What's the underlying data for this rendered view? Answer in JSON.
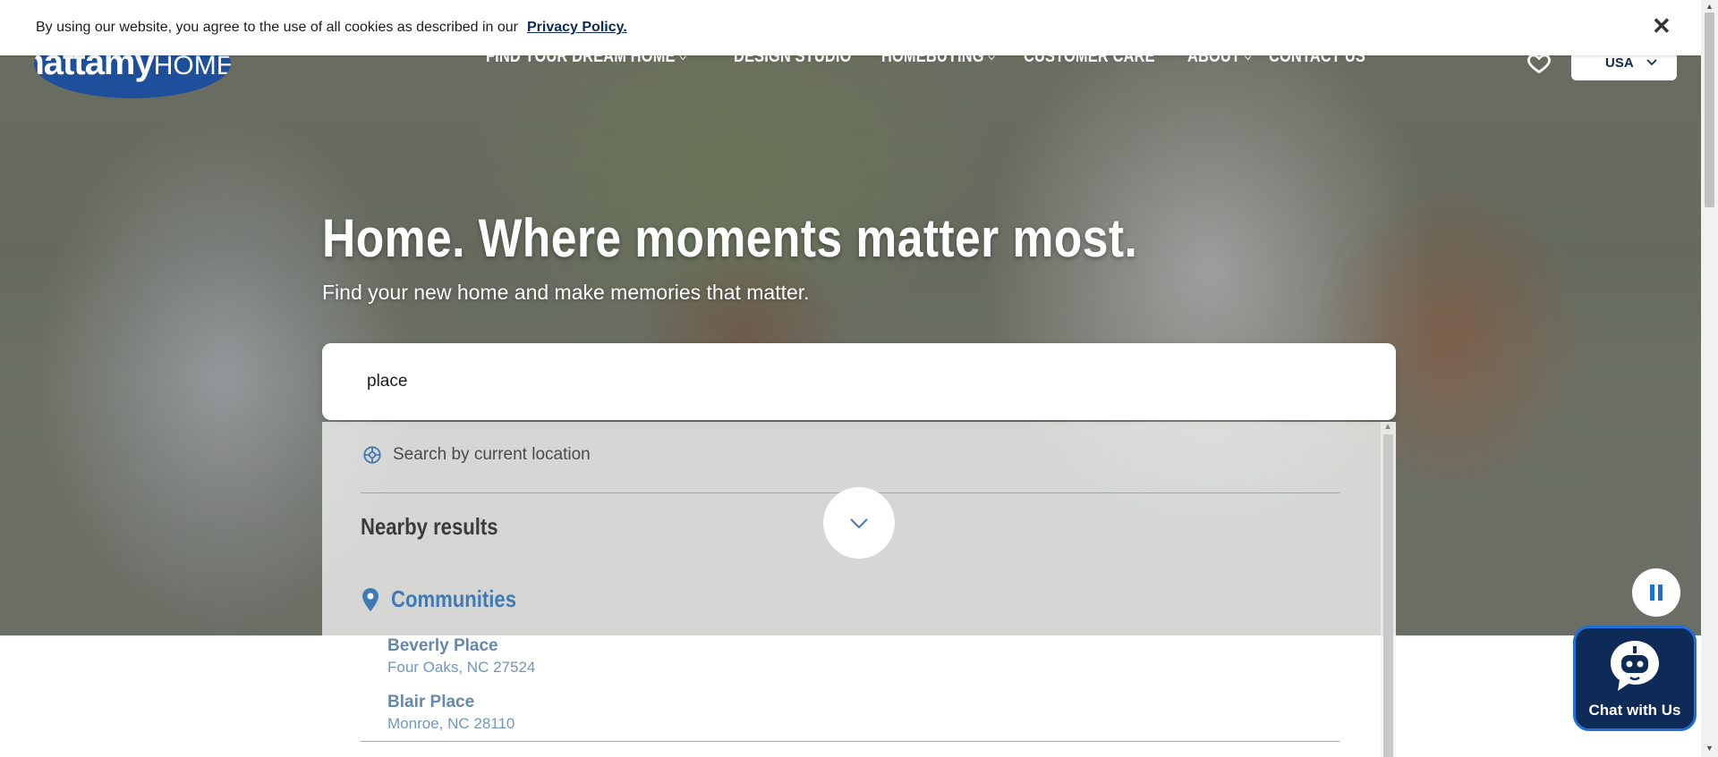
{
  "header": {
    "logo_main": "mattamy",
    "logo_sub": "HOMES",
    "nav": [
      {
        "label": "FIND YOUR DREAM HOME",
        "has_dropdown": true
      },
      {
        "label": "DESIGN STUDIO",
        "has_dropdown": false
      },
      {
        "label": "HOMEBUYING",
        "has_dropdown": true
      },
      {
        "label": "CUSTOMER CARE",
        "has_dropdown": false
      },
      {
        "label": "ABOUT",
        "has_dropdown": true
      },
      {
        "label": "CONTACT US",
        "has_dropdown": false
      }
    ],
    "country": "USA"
  },
  "cookie_banner": {
    "text": "By using our website, you agree to the use of all cookies as described in our",
    "link": "Privacy Policy.",
    "close": "✕"
  },
  "hero": {
    "headline": "Home. Where moments matter most.",
    "subhead": "Find your new home and make memories that matter."
  },
  "search": {
    "value": "place",
    "current_location": "Search by current location",
    "nearby_heading": "Nearby results",
    "communities_heading": "Communities",
    "results": [
      {
        "name": "Beverly Place",
        "address": "Four Oaks, NC 27524"
      },
      {
        "name": "Blair Place",
        "address": "Monroe, NC 28110"
      }
    ]
  },
  "chat": {
    "label": "Chat with Us"
  },
  "colors": {
    "brand": "#0e2a56",
    "logo": "#1d4f9a",
    "accent": "#3f7ab5",
    "divider": "#73b6c8"
  },
  "icons": [
    "heart-icon",
    "chevron-down-icon",
    "crosshair-icon",
    "pin-icon",
    "pause-icon",
    "chatbot-icon",
    "close-icon"
  ]
}
